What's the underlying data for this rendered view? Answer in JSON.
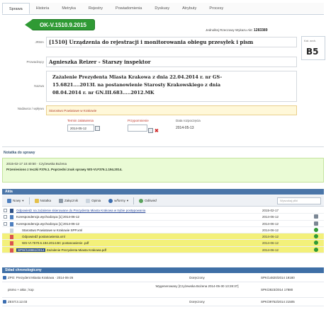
{
  "tabs": [
    "Sprawa",
    "Historia",
    "Metryka",
    "Rejestry",
    "Powiadomienia",
    "Dyskusy",
    "Atrybuty",
    "Procesy"
  ],
  "case_number": "OK-V.1510.9.2015",
  "meta": {
    "label": "Jednolitej Rzeczowy Wykazu Akt:",
    "value": "1283389"
  },
  "side": {
    "label": "Kat. arch.",
    "value": "B5"
  },
  "labels": {
    "jrwa": "JRWA",
    "prowadzacy": "Prowadzący",
    "nazwa": "Nazwa",
    "nadawca": "Nadawca / wpływu",
    "termin": "Termin załatwienia",
    "przypomnienie": "Przypomnienie",
    "data_rozp": "Data rozpoczęcia"
  },
  "fields": {
    "title": "[1510] Urządzenia do rejestracji i monitorowania obiegu przesyłek i pism",
    "person": "Agnieszka Reizer - Starszy inspektor",
    "desc_lines": [
      "Zażalenie Prezydenta Miasta Krakowa z dnia 22.04.2014 r. nr GS-",
      "15.6821....2013L na postanowienie Starosty Krakowskiego z dnia",
      "08.04.2014 r. nr GN.III.683.....2012.MK"
    ],
    "over": "Starostwo Powiatowe w Krakowie",
    "termin_value": "2014-05-12",
    "przypomnienie_value": "",
    "data_rozp_value": "2014-05-13"
  },
  "note": {
    "title": "Notatka do sprawy",
    "line1": "2015-02-17 10:40:50 · Czyżewska Bożena",
    "line2": "Przeniesiono z teczki F376.1. Poprzedni znak sprawy WS-VI.F376.1.194.2014."
  },
  "docs_panel": {
    "title": "Akta",
    "toolbar": [
      "Nowy",
      "Notatka",
      "Załącznik",
      "Opinia",
      "w/formy",
      "Odświeź"
    ],
    "search_placeholder": "Wyszukaj pliki"
  },
  "docs": [
    {
      "text": "Odpowiedz na zażalenie skierowane do Prezydenta Miasta Krakowa w trybie postępowania",
      "date": "2015-02-17",
      "link": true
    },
    {
      "text": "Korespondencja wychodząca [1] 2014-06-12",
      "date": "2014-06-12",
      "link": false
    },
    {
      "text": "Korespondencja wychodząca [1] 2014-06-12",
      "date": "2014-06-12",
      "link": false
    },
    {
      "text": "Starostwo Powiatowe w Krakowie SPP.xml",
      "date": "2014-06-12",
      "link": false
    },
    {
      "text": "Odpowiedź postanowienia.xml",
      "date": "2014-06-12",
      "link": false
    },
    {
      "text": "WS-VI.7570.6.194.2014.BC postanowienie .pdf",
      "date": "2014-06-12",
      "link": false
    },
    {
      "text": "Zażalenie Prezydenta Miasta Krakowa.pdf",
      "date": "2014-06-12",
      "link": false
    }
  ],
  "doc_badge": "SPW/118861/2014",
  "chrono": {
    "title": "Skład chronologiczny",
    "rows": [
      {
        "c1": "ZPO: Prezydent Miasta Krakowa · 2014-06-26",
        "c2": "Doręczony",
        "c3": "SPK/14820/2014 19180"
      },
      {
        "c1": "pismo + akta ; kop",
        "c2": "Wygenerowany [Czyżewska Bożena 2014-05-30 13:28:37]",
        "c3": "SPK/2823/2014 17880"
      },
      {
        "c1": "ZEST.3.12.03",
        "c2": "Doręczony",
        "c3": "SPK/39752/2014 21505"
      }
    ]
  }
}
